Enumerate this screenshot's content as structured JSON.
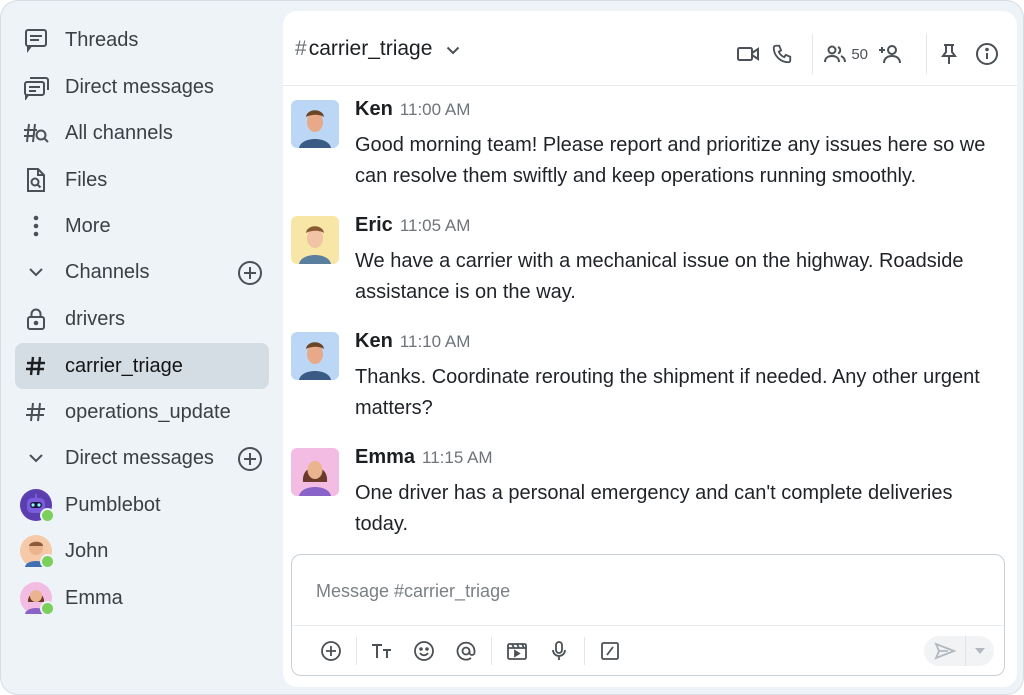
{
  "sidebar": {
    "nav": [
      {
        "label": "Threads",
        "icon": "threads-icon"
      },
      {
        "label": "Direct messages",
        "icon": "direct-messages-icon"
      },
      {
        "label": "All channels",
        "icon": "channel-search-icon"
      },
      {
        "label": "Files",
        "icon": "file-search-icon"
      },
      {
        "label": "More",
        "icon": "more-vertical-icon"
      }
    ],
    "channels_section": {
      "label": "Channels"
    },
    "channels": [
      {
        "label": "drivers",
        "icon": "lock-icon"
      },
      {
        "label": "carrier_triage",
        "icon": "hash-icon",
        "active": true
      },
      {
        "label": "operations_update",
        "icon": "hash-icon"
      }
    ],
    "dm_section": {
      "label": "Direct messages"
    },
    "dms": [
      {
        "label": "Pumblebot"
      },
      {
        "label": "John"
      },
      {
        "label": "Emma"
      }
    ]
  },
  "header": {
    "hash": "#",
    "channel_name": "carrier_triage",
    "member_count": "50"
  },
  "messages": [
    {
      "name": "Ken",
      "time": "11:00 AM",
      "text": "Good morning team! Please report and prioritize any issues here so we can resolve them swiftly and keep operations running smoothly."
    },
    {
      "name": "Eric",
      "time": "11:05 AM",
      "text": "We have a carrier with a mechanical issue on the highway. Roadside assistance is on the way."
    },
    {
      "name": "Ken",
      "time": "11:10 AM",
      "text": "Thanks. Coordinate rerouting the shipment if needed. Any other urgent matters?"
    },
    {
      "name": "Emma",
      "time": "11:15 AM",
      "text": "One driver has a personal emergency and can't complete deliveries today."
    }
  ],
  "composer": {
    "placeholder": "Message #carrier_triage",
    "value": ""
  },
  "colors": {
    "sidebar_bg": "#eef3f7",
    "active_item_bg": "#d5dde4",
    "online": "#7ccf5a",
    "avatar_ken_bg": "#bcd6f5",
    "avatar_eric_bg": "#f8e6a6",
    "avatar_emma_bg": "#f3bde3"
  }
}
